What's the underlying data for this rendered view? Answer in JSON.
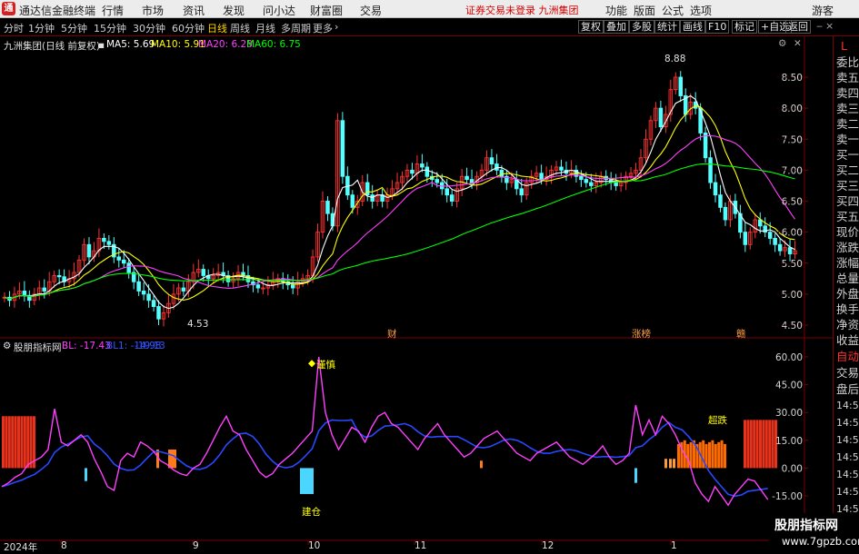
{
  "app": {
    "title": "通达信金融终端",
    "menu": [
      "行情",
      "市场",
      "资讯",
      "发现",
      "问小达",
      "财富圈",
      "交易"
    ],
    "notice": "证券交易未登录  九洲集团",
    "right_menu": [
      "功能",
      "版面",
      "公式",
      "选项",
      "游客"
    ]
  },
  "toolbar": {
    "periods": [
      "分时",
      "1分钟",
      "5分钟",
      "15分钟",
      "30分钟",
      "60分钟",
      "日线",
      "周线",
      "月线",
      "多周期",
      "更多"
    ],
    "active_period": "日线",
    "right_buttons": [
      "复权",
      "叠加",
      "多股",
      "统计",
      "画线",
      "F10",
      "标记",
      "+自选",
      "返回"
    ]
  },
  "right_panel": {
    "top_letter": "L",
    "items": [
      "委比",
      "卖五",
      "卖四",
      "卖三",
      "卖二",
      "卖一",
      "买一",
      "买二",
      "买三",
      "买四",
      "买五",
      "现价",
      "涨跌",
      "涨幅",
      "总量",
      "外盘",
      "换手",
      "净资",
      "收益"
    ],
    "lower_items": [
      "自动",
      "交易",
      "盘后"
    ],
    "times": [
      "14:56",
      "14:56",
      "14:56",
      "14:56",
      "14:56",
      "14:56",
      "14:56",
      "14:56",
      "14:56"
    ]
  },
  "main_chart": {
    "stock_label": "九洲集团(日线 前复权)",
    "ma_legend": [
      {
        "label": "MA5: 5.69",
        "color": "#ffffff"
      },
      {
        "label": "MA10: 5.91",
        "color": "#ffff00"
      },
      {
        "label": "MA20: 6.28",
        "color": "#ff40ff"
      },
      {
        "label": "MA60: 6.75",
        "color": "#00ff00"
      }
    ],
    "y_ticks": [
      "8.50",
      "8.00",
      "7.50",
      "7.00",
      "6.50",
      "6.00",
      "5.50",
      "5.00",
      "4.50"
    ],
    "high_label": "8.88",
    "low_label": "4.53",
    "markers": [
      "财",
      "涨榜",
      "赣"
    ]
  },
  "indicator": {
    "name": "股朋指标网",
    "legend": [
      {
        "label": "BL: -17.43",
        "color": "#ff40ff"
      },
      {
        "label": "BL1: -14.98",
        "color": "#3355ff"
      },
      {
        "label": "-19.13",
        "color": "#3355ff"
      }
    ],
    "y_ticks": [
      "60.00",
      "45.00",
      "30.00",
      "15.00",
      "0.00",
      "-15.00"
    ],
    "annotations": [
      "谨慎",
      "建仓",
      "超跌"
    ]
  },
  "x_axis": [
    "2024年",
    "8",
    "9",
    "10",
    "11",
    "12",
    "1"
  ],
  "colors": {
    "up": "#ff3232",
    "down": "#54ffff",
    "ma5": "#ffffff",
    "ma10": "#ffff00",
    "ma20": "#ff40ff",
    "ma60": "#00ff00",
    "grid": "#7a0000"
  },
  "watermark": {
    "line1": "股朋指标网",
    "line2": "www.7gpzb.com"
  }
}
